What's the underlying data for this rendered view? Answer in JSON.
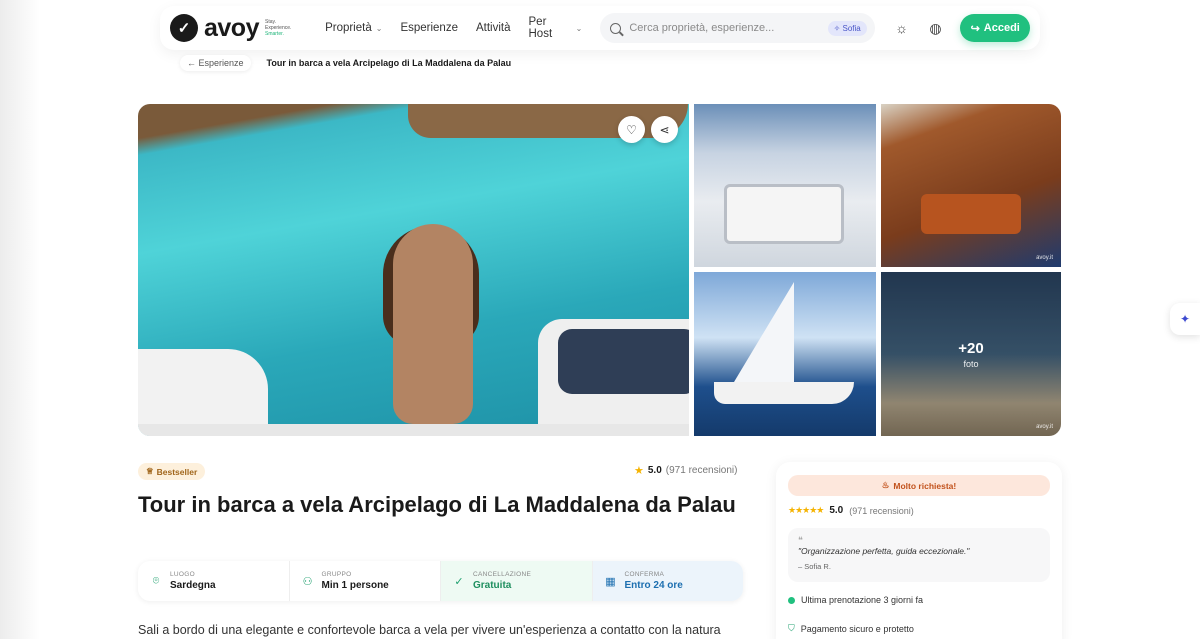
{
  "header": {
    "logo_text": "avoy",
    "logo_tag_1": "Stay.",
    "logo_tag_2": "Experience.",
    "logo_tag_3": "Smarter.",
    "nav": [
      {
        "label": "Proprietà",
        "has_dropdown": true
      },
      {
        "label": "Esperienze",
        "has_dropdown": false
      },
      {
        "label": "Attività",
        "has_dropdown": false
      },
      {
        "label": "Per Host",
        "has_dropdown": true
      }
    ],
    "search_placeholder": "Cerca proprietà, esperienze...",
    "sofia_label": "Sofia",
    "login_label": "Accedi",
    "accent_color": "#20c07f"
  },
  "breadcrumb": {
    "back_label": "Esperienze",
    "current": "Tour in barca a vela Arcipelago di La Maddalena da Palau"
  },
  "gallery": {
    "more_count": "+20",
    "more_label": "foto",
    "watermark": "avoy.it"
  },
  "listing": {
    "badge": "Bestseller",
    "rating": "5.0",
    "reviews": "(971 recensioni)",
    "title": "Tour in barca a vela Arcipelago di La Maddalena da Palau",
    "info": [
      {
        "label": "LUOGO",
        "value": "Sardegna",
        "icon": "location-icon"
      },
      {
        "label": "GRUPPO",
        "value": "Min 1 persone",
        "icon": "group-icon"
      },
      {
        "label": "CANCELLAZIONE",
        "value": "Gratuita",
        "icon": "check-icon"
      },
      {
        "label": "CONFERMA",
        "value": "Entro 24 ore",
        "icon": "calendar-icon"
      }
    ],
    "description": "Sali a bordo di una elegante e confortevole barca a vela per vivere un'esperienza a contatto con la natura"
  },
  "booking": {
    "hot_label": "Molto richiesta!",
    "rating": "5.0",
    "reviews": "(971 recensioni)",
    "quote": "\"Organizzazione perfetta, guida eccezionale.\"",
    "quote_author": "– Sofia R.",
    "last_booking": "Ultima prenotazione 3 giorni fa",
    "secure_payment": "Pagamento sicuro e protetto"
  }
}
